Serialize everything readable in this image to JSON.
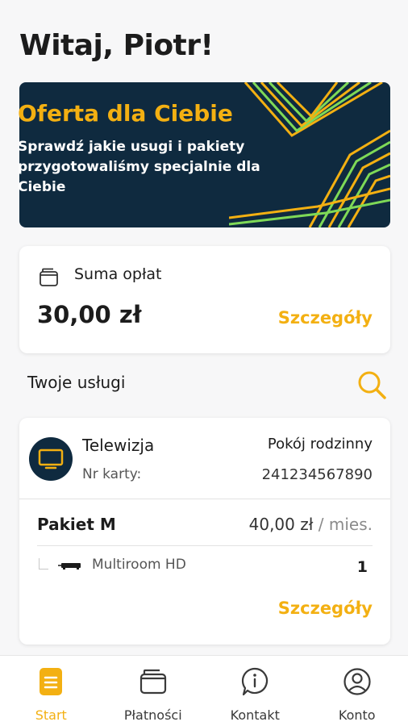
{
  "header": {
    "greeting": "Witaj, Piotr!"
  },
  "banner": {
    "title": "Oferta dla Ciebie",
    "text": "Sprawdź jakie usugi i pakiety przygotowaliśmy specjalnie dla Ciebie",
    "colors": {
      "background": "#0f2a3f",
      "title": "#f3b012",
      "stripes": [
        "#f3b012",
        "#7ed957"
      ]
    }
  },
  "summary": {
    "icon": "wallet-icon",
    "label": "Suma opłat",
    "amount": "30,00 zł",
    "details_link": "Szczegóły"
  },
  "services": {
    "title": "Twoje usługi",
    "search_icon": "search-icon",
    "items": [
      {
        "icon": "tv-icon",
        "name": "Telewizja",
        "room": "Pokój rodzinny",
        "card_label": "Nr karty:",
        "card_number": "241234567890",
        "package": {
          "name": "Pakiet M",
          "price": "40,00 zł",
          "period": " / mies."
        },
        "addons": [
          {
            "icon": "set-top-box-icon",
            "name": "Multiroom HD",
            "quantity": "1"
          }
        ],
        "details_link": "Szczegóły"
      }
    ]
  },
  "nav": {
    "active": "start",
    "items": [
      {
        "id": "start",
        "label": "Start",
        "icon": "document-icon"
      },
      {
        "id": "payments",
        "label": "Płatności",
        "icon": "wallet-icon"
      },
      {
        "id": "contact",
        "label": "Kontakt",
        "icon": "info-chat-icon"
      },
      {
        "id": "account",
        "label": "Konto",
        "icon": "user-icon"
      }
    ]
  },
  "colors": {
    "accent": "#f3b012",
    "dark_navy": "#0f2a3f",
    "text": "#1c1c1c"
  }
}
